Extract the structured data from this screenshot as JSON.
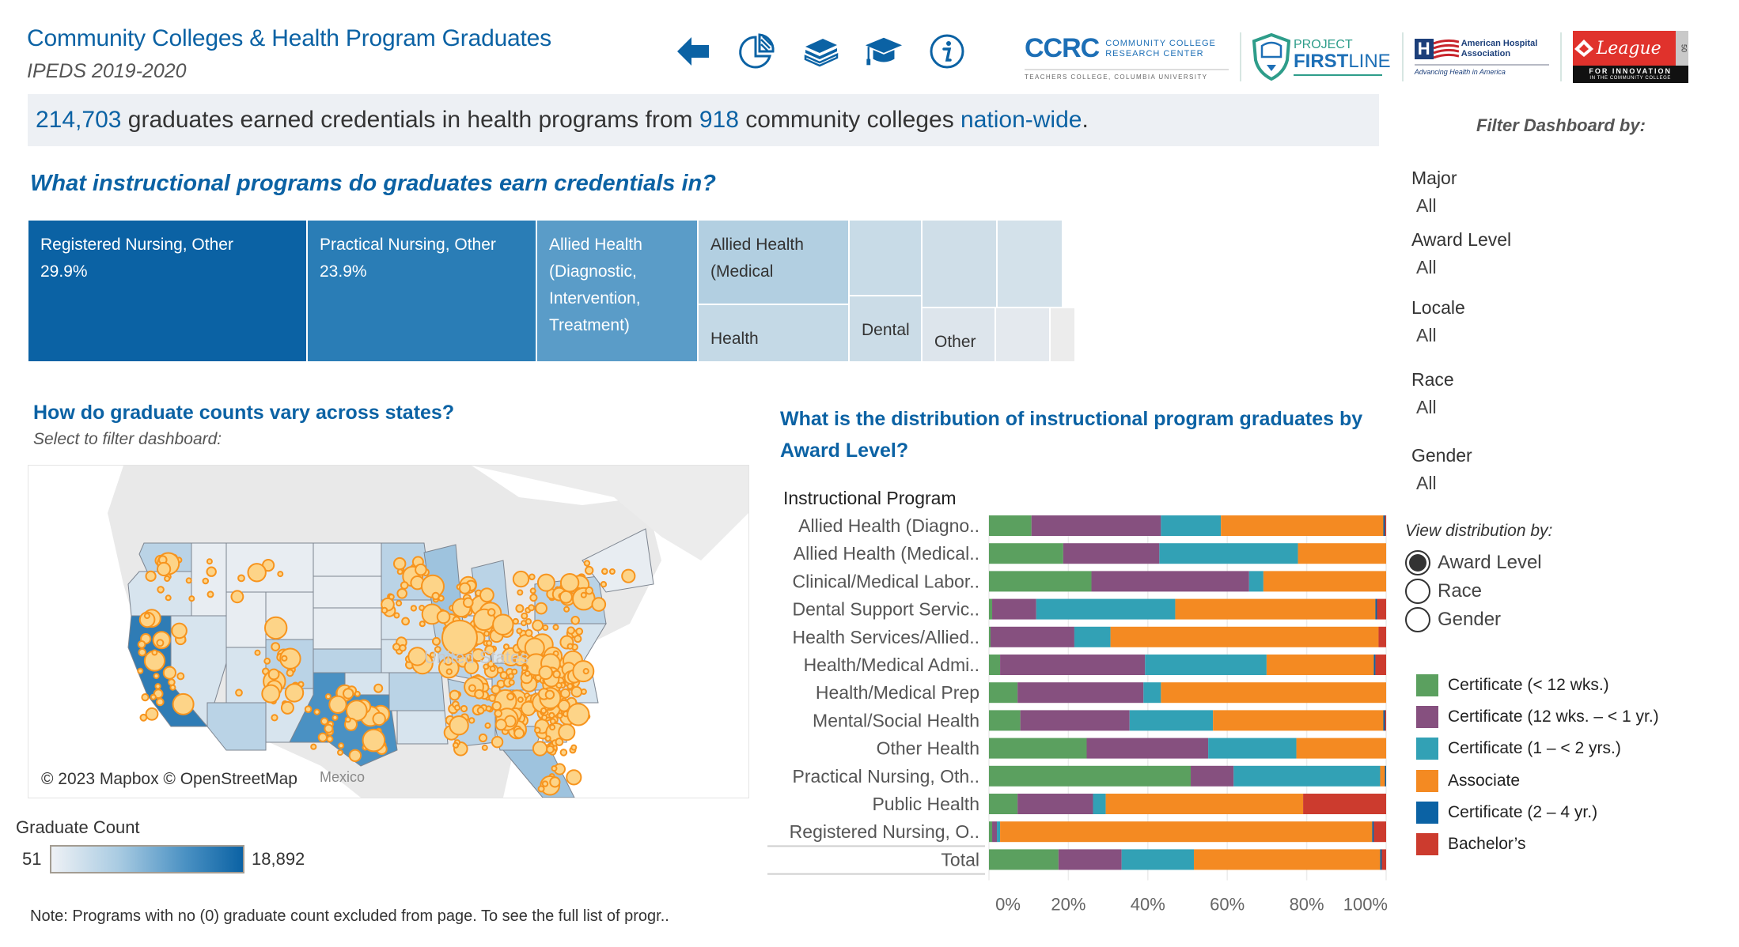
{
  "header": {
    "title": "Community Colleges & Health Program Graduates",
    "subtitle": "IPEDS 2019-2020",
    "nav_icons": [
      "back-arrow-icon",
      "pie-chart-icon",
      "books-icon",
      "graduation-cap-icon",
      "info-icon"
    ],
    "logos": {
      "ccrc": {
        "mark": "CCRC",
        "line1": "COMMUNITY COLLEGE",
        "line2": "RESEARCH CENTER",
        "tagline": "TEACHERS COLLEGE, COLUMBIA UNIVERSITY"
      },
      "firstline": {
        "line1": "PROJECT",
        "line2a": "FIRST",
        "line2b": "LINE"
      },
      "aha": {
        "mark": "H",
        "line1": "American Hospital",
        "line2": "Association",
        "tagline": "Advancing Health in America"
      },
      "league": {
        "script": "League",
        "line1": "FOR INNOVATION",
        "line2": "IN THE COMMUNITY COLLEGE",
        "badge": "50"
      }
    }
  },
  "banner": {
    "grads": "214,703",
    "text1": " graduates earned credentials in health programs from ",
    "colleges": "918",
    "text2": " community colleges ",
    "scope": "nation-wide",
    "text3": "."
  },
  "treemap": {
    "question": "What instructional programs do graduates earn credentials in?",
    "cells": [
      {
        "label": "Registered Nursing, Other",
        "pct": "29.9%",
        "color": "#0b62a4"
      },
      {
        "label": "Practical Nursing, Other",
        "pct": "23.9%",
        "color": "#2a7db6"
      },
      {
        "label": "Allied Health (Diagnostic, Intervention, Treatment)",
        "pct": "",
        "color": "#5a9cc8"
      },
      {
        "label": "Allied Health (Medical",
        "pct": "",
        "color": "#b2cfe1"
      },
      {
        "label": "Health",
        "pct": "",
        "color": "#c4d9e6"
      },
      {
        "label": "",
        "pct": "",
        "color": "#c8dbe7"
      },
      {
        "label": "Dental",
        "pct": "",
        "color": "#cbdce7"
      },
      {
        "label": "",
        "pct": "",
        "color": "#cfdee8"
      },
      {
        "label": "",
        "pct": "",
        "color": "#d3e1ea"
      },
      {
        "label": "Other",
        "pct": "",
        "color": "#dde5ec"
      },
      {
        "label": "",
        "pct": "",
        "color": "#e4e9ee"
      },
      {
        "label": "",
        "pct": "",
        "color": "#ececec"
      }
    ]
  },
  "map": {
    "question": "How do graduate counts vary across states?",
    "subtitle": "Select to filter dashboard:",
    "country_label": "United States",
    "mexico_label": "Mexico",
    "credit": "© 2023 Mapbox © OpenStreetMap",
    "legend": {
      "title": "Graduate Count",
      "min": "51",
      "max": "18,892"
    }
  },
  "note": "Note: Programs with no (0) graduate count excluded from page.  To see the full list of progr..",
  "filters": {
    "title": "Filter Dashboard by:",
    "items": [
      {
        "label": "Major",
        "value": "All"
      },
      {
        "label": "Award Level",
        "value": "All"
      },
      {
        "label": "Locale",
        "value": "All"
      },
      {
        "label": "Race",
        "value": "All"
      },
      {
        "label": "Gender",
        "value": "All"
      }
    ]
  },
  "view_by": {
    "title": "View distribution by:",
    "options": [
      {
        "label": "Award Level",
        "selected": true
      },
      {
        "label": "Race",
        "selected": false
      },
      {
        "label": "Gender",
        "selected": false
      }
    ]
  },
  "chart_data": {
    "type": "bar",
    "orientation": "horizontal",
    "stacked": "100%",
    "title": "What is the distribution of instructional program graduates by Award Level?",
    "row_header": "Instructional Program",
    "categories": [
      "Allied Health (Diagno..",
      "Allied Health (Medical..",
      "Clinical/Medical Labor..",
      "Dental Support Servic..",
      "Health Services/Allied..",
      "Health/Medical Admi..",
      "Health/Medical Prep",
      "Mental/Social Health",
      "Other Health",
      "Practical Nursing, Oth..",
      "Public Health",
      "Registered Nursing, O..",
      "Total"
    ],
    "x_ticks": [
      "0%",
      "20%",
      "40%",
      "60%",
      "80%",
      "100%"
    ],
    "xlim": [
      0,
      100
    ],
    "grid": true,
    "legend_position": "right",
    "series": [
      {
        "name": "Certificate (< 12 wks.)",
        "color": "#5ba05f",
        "values": [
          10.7,
          18.7,
          25.8,
          0.8,
          0.4,
          2.8,
          7.2,
          7.9,
          24.6,
          50.8,
          7.2,
          0.8,
          17.5
        ]
      },
      {
        "name": "Certificate (12 wks. – < 1 yr.)",
        "color": "#86507f",
        "values": [
          32.6,
          24.2,
          39.7,
          11.1,
          21.1,
          36.5,
          31.7,
          27.5,
          30.6,
          10.8,
          19.0,
          1.2,
          15.9
        ]
      },
      {
        "name": "Certificate (1 – < 2 yrs.)",
        "color": "#32a1b5",
        "values": [
          15.1,
          34.9,
          3.6,
          35.0,
          9.1,
          30.6,
          4.4,
          21.0,
          22.2,
          36.9,
          3.2,
          0.8,
          18.2
        ]
      },
      {
        "name": "Associate",
        "color": "#f48a22",
        "values": [
          40.9,
          22.2,
          30.9,
          50.4,
          67.5,
          27.0,
          56.7,
          42.9,
          22.6,
          1.2,
          49.7,
          93.7,
          46.9
        ]
      },
      {
        "name": "Certificate (2 – 4 yr.)",
        "color": "#0b62a4",
        "values": [
          0.4,
          0,
          0,
          0.4,
          0,
          0.4,
          0,
          0.4,
          0,
          0.3,
          0,
          0.4,
          0.4
        ]
      },
      {
        "name": "Bachelor’s",
        "color": "#cc3b2e",
        "values": [
          0.3,
          0,
          0,
          2.3,
          1.9,
          2.7,
          0,
          0.3,
          0,
          0,
          20.9,
          3.1,
          1.1
        ]
      }
    ]
  }
}
